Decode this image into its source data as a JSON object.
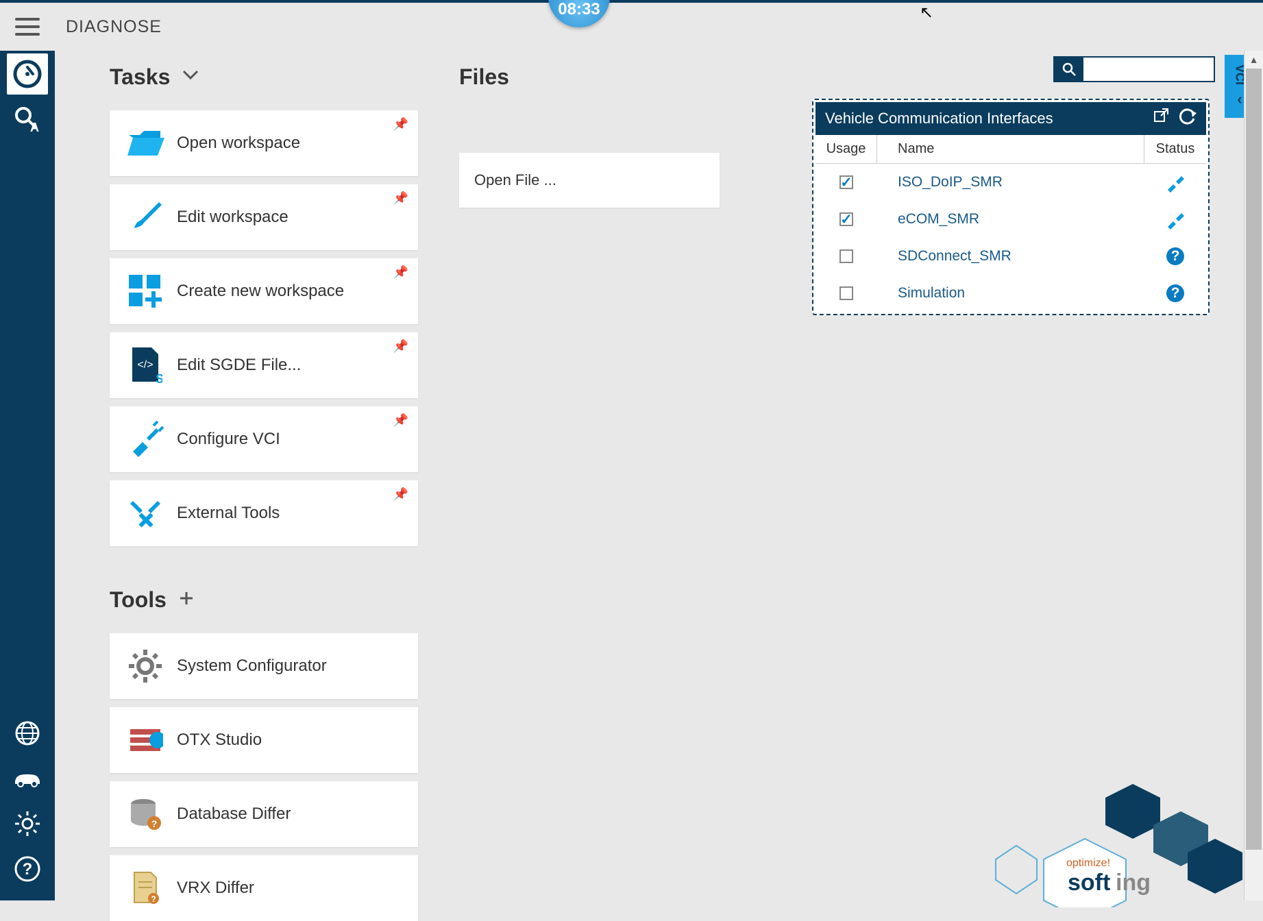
{
  "header": {
    "title": "DIAGNOSE",
    "time": "08:33"
  },
  "tasks": {
    "heading": "Tasks",
    "items": [
      {
        "label": "Open workspace"
      },
      {
        "label": "Edit workspace"
      },
      {
        "label": "Create new workspace"
      },
      {
        "label": "Edit SGDE File..."
      },
      {
        "label": "Configure VCI"
      },
      {
        "label": "External Tools"
      }
    ]
  },
  "tools": {
    "heading": "Tools",
    "items": [
      {
        "label": "System Configurator"
      },
      {
        "label": "OTX Studio"
      },
      {
        "label": "Database Differ"
      },
      {
        "label": "VRX Differ"
      }
    ]
  },
  "files": {
    "heading": "Files",
    "open_label": "Open File ..."
  },
  "search": {
    "value": ""
  },
  "vci_tab": {
    "label": "VCI",
    "arrow": "‹"
  },
  "vci_panel": {
    "title": "Vehicle Communication Interfaces",
    "columns": {
      "usage": "Usage",
      "name": "Name",
      "status": "Status"
    },
    "rows": [
      {
        "checked": true,
        "name": "ISO_DoIP_SMR",
        "status": "connected"
      },
      {
        "checked": true,
        "name": "eCOM_SMR",
        "status": "connected"
      },
      {
        "checked": false,
        "name": "SDConnect_SMR",
        "status": "help"
      },
      {
        "checked": false,
        "name": "Simulation",
        "status": "help"
      }
    ]
  },
  "logo": {
    "top": "optimize!",
    "main": "softing"
  }
}
